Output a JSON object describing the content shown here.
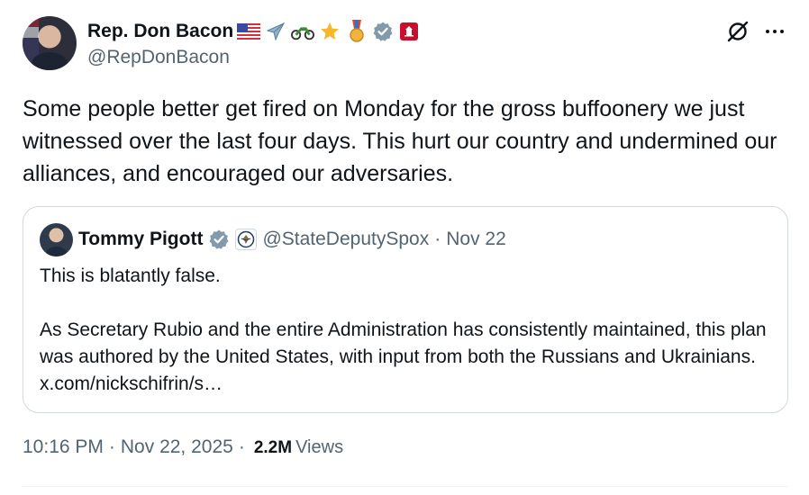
{
  "author": {
    "name": "Rep. Don Bacon",
    "handle": "@RepDonBacon",
    "badges": [
      "us-flag-emoji",
      "airplane-emoji",
      "motorcycle-emoji",
      "star-emoji",
      "medal-emoji",
      "verified-badge-icon",
      "house-seal-icon"
    ]
  },
  "tweet": {
    "text": "Some people better get fired on Monday for the gross buffoonery we just witnessed over the last four days. This hurt our country and undermined our alliances, and encouraged our adversaries."
  },
  "quote": {
    "name": "Tommy Pigott",
    "handle": "@StateDeputySpox",
    "separator": "·",
    "date": "Nov 22",
    "text": "This is blatantly false.\n\nAs Secretary Rubio and the entire Administration has consistently maintained, this plan was authored by the United States, with input from both the Russians and Ukrainians. x.com/nickschifrin/s…"
  },
  "meta": {
    "time": "10:16 PM",
    "separator": "·",
    "date": "Nov 22, 2025",
    "separator2": "·",
    "views_count": "2.2M",
    "views_label": "Views"
  },
  "colors": {
    "text_primary": "#0f1419",
    "text_secondary": "#536471",
    "verified_gray": "#829aab",
    "border": "#cfd9de"
  }
}
